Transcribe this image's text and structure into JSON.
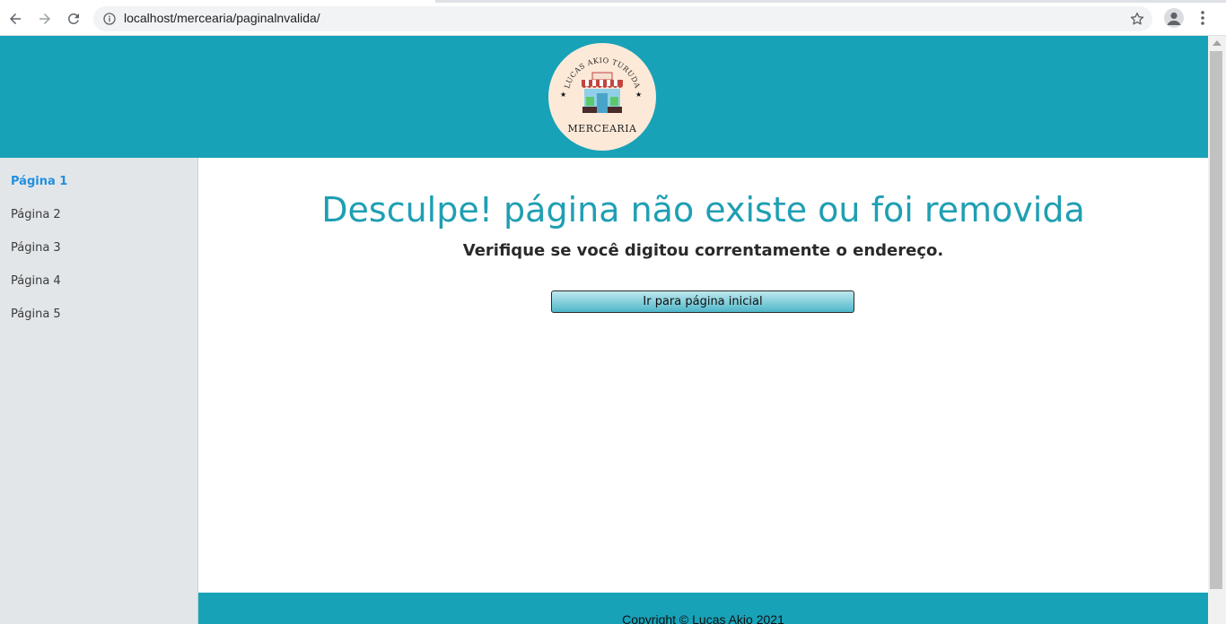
{
  "browser": {
    "url": "localhost/mercearia/paginalnvalida/",
    "icons": {
      "back": "back-arrow-icon",
      "forward": "forward-arrow-icon",
      "reload": "reload-icon",
      "info": "info-icon",
      "bookmark": "star-icon",
      "profile": "profile-icon",
      "menu": "kebab-menu-icon"
    }
  },
  "header": {
    "logo": {
      "brand_name": "LUCAS AKIO TURUDA",
      "shop_name": "MERCEARIA"
    },
    "background_color": "#18a2b8"
  },
  "sidebar": {
    "items": [
      {
        "label": "Página 1",
        "active": true
      },
      {
        "label": "Página 2",
        "active": false
      },
      {
        "label": "Página 3",
        "active": false
      },
      {
        "label": "Página 4",
        "active": false
      },
      {
        "label": "Página 5",
        "active": false
      }
    ],
    "active_color": "#1f8fe0"
  },
  "main": {
    "title": "Desculpe! página não existe ou foi removida",
    "subtitle": "Verifique se você digitou correntamente o endereço.",
    "home_button_label": "Ir para página inicial",
    "title_color": "#1f9fb3"
  },
  "footer": {
    "copyright": "Copyright © Lucas Akio 2021"
  }
}
